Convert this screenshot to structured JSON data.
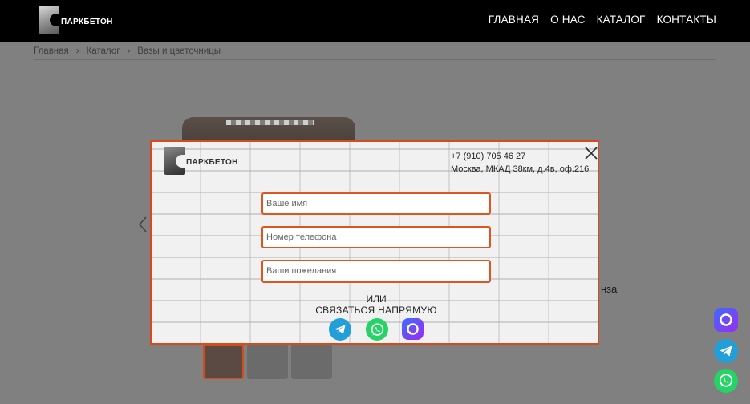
{
  "header": {
    "logo_text": "ПАРКБЕТОН",
    "nav": [
      {
        "label": "ГЛАВНАЯ"
      },
      {
        "label": "О НАС"
      },
      {
        "label": "КАТАЛОГ"
      },
      {
        "label": "КОНТАКТЫ"
      }
    ]
  },
  "breadcrumb": {
    "items": [
      "Главная",
      "Каталог",
      "Вазы и цветочницы"
    ],
    "separator": "›"
  },
  "background": {
    "partial_text": "нза"
  },
  "modal": {
    "logo_text": "ПАРКБЕТОН",
    "phone": "+7 (910) 705 46 27",
    "address": "Москва, МКАД 38км, д.4в, оф.216",
    "fields": {
      "name_placeholder": "Ваше имя",
      "phone_placeholder": "Номер телефона",
      "wishes_placeholder": "Ваши пожелания"
    },
    "or_label": "ИЛИ",
    "direct_label": "СВЯЗАТЬСЯ НАПРЯМУЮ",
    "messengers": [
      "telegram-icon",
      "whatsapp-icon",
      "max-messenger-icon"
    ]
  },
  "colors": {
    "accent": "#d44b1c",
    "header_bg": "#000000",
    "overlay": "#808080",
    "telegram": "#229ed9",
    "whatsapp": "#25d366"
  }
}
